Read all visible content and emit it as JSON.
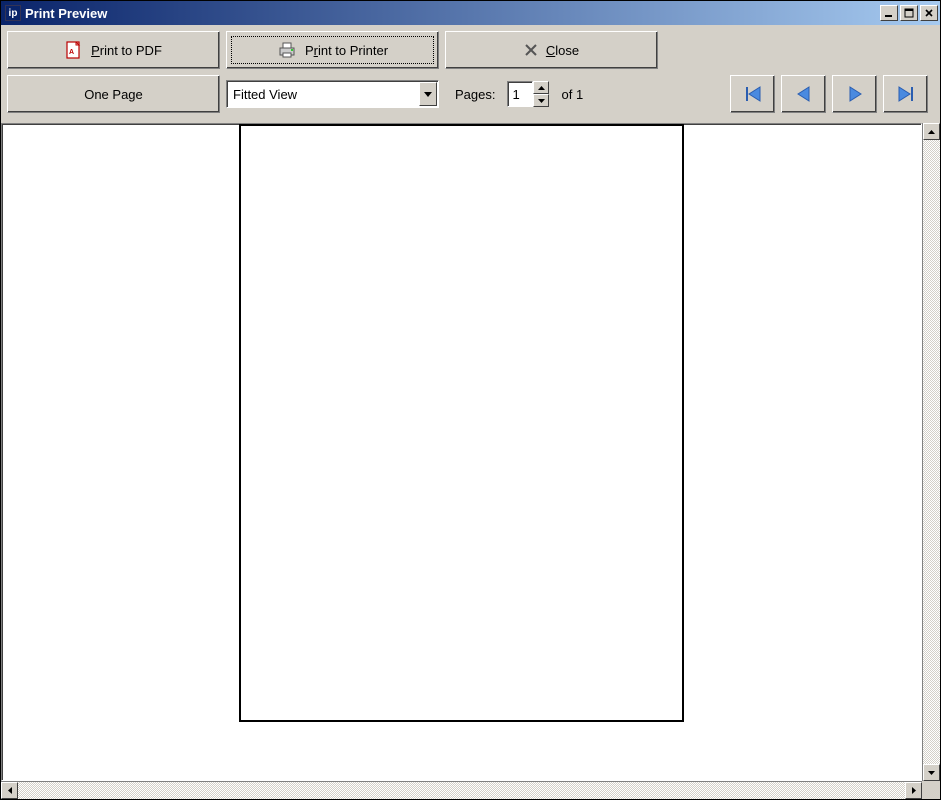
{
  "window": {
    "title": "Print Preview",
    "app_icon_text": "ip"
  },
  "toolbar": {
    "print_pdf_label": "Print to PDF",
    "print_pdf_mnemonic": "P",
    "print_printer_prefix": "P",
    "print_printer_mnemonic": "r",
    "print_printer_suffix": "int to Printer",
    "close_mnemonic": "C",
    "close_suffix": "lose",
    "one_page_label": "One Page",
    "view_dropdown_value": "Fitted View",
    "pages_label": "Pages:",
    "page_current": "1",
    "page_of_prefix": "of ",
    "page_total": "1"
  }
}
